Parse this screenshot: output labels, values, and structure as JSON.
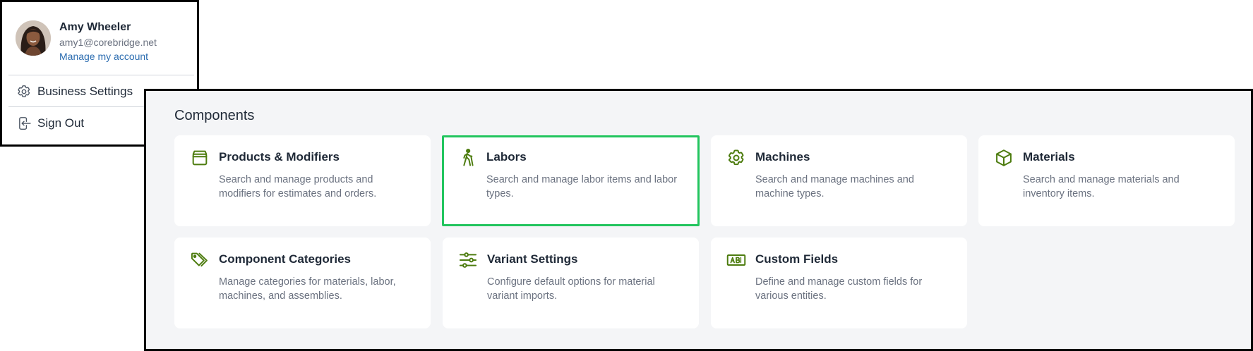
{
  "account": {
    "name": "Amy Wheeler",
    "email": "amy1@corebridge.net",
    "manage_link": "Manage my account",
    "menu": [
      {
        "label": "Business Settings",
        "icon": "gear-icon"
      },
      {
        "label": "Sign Out",
        "icon": "sign-out-icon"
      }
    ]
  },
  "components": {
    "title": "Components",
    "cards": [
      {
        "title": "Products & Modifiers",
        "description": "Search and manage products and modifiers for estimates and orders.",
        "icon": "box-icon"
      },
      {
        "title": "Labors",
        "description": "Search and manage labor items and labor types.",
        "icon": "walking-person-icon",
        "highlighted": true
      },
      {
        "title": "Machines",
        "description": "Search and manage machines and machine types.",
        "icon": "gear-icon"
      },
      {
        "title": "Materials",
        "description": "Search and manage materials and inventory items.",
        "icon": "cube-icon"
      },
      {
        "title": "Component Categories",
        "description": "Manage categories for materials, labor, machines, and assemblies.",
        "icon": "tags-icon"
      },
      {
        "title": "Variant Settings",
        "description": "Configure default options for material variant imports.",
        "icon": "sliders-icon"
      },
      {
        "title": "Custom Fields",
        "description": "Define and manage custom fields for various entities.",
        "icon": "text-field-icon"
      }
    ]
  },
  "colors": {
    "accent_icon": "#4d7c0f",
    "highlight_border": "#22c55e",
    "link": "#2b6cb0"
  }
}
